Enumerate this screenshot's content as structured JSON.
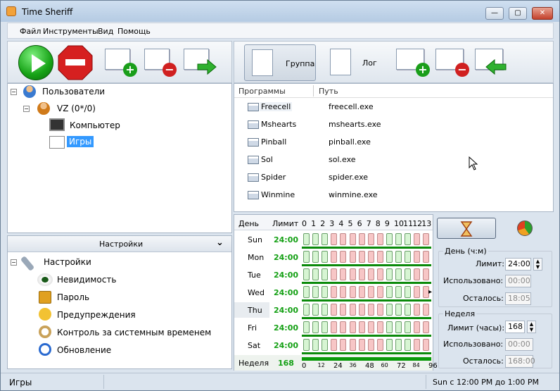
{
  "window": {
    "title": "Time Sheriff",
    "minimize": "—",
    "maximize": "▢",
    "close": "✕"
  },
  "menu": [
    "Файл",
    "Инструменты",
    "Вид",
    "Помощь"
  ],
  "toolbar_right": {
    "group_label": "Группа",
    "log_label": "Лог"
  },
  "users_tree": {
    "root": "Пользователи",
    "user": "VZ (0*/0)",
    "computer": "Компьютер",
    "games": "Игры"
  },
  "settings": {
    "header": "Настройки",
    "root": "Настройки",
    "items": [
      "Невидимость",
      "Пароль",
      "Предупреждения",
      "Контроль за системным временем",
      "Обновление"
    ]
  },
  "programs": {
    "col_programs": "Программы",
    "col_path": "Путь",
    "rows": [
      {
        "name": "Freecell",
        "path": "freecell.exe"
      },
      {
        "name": "Mshearts",
        "path": "mshearts.exe"
      },
      {
        "name": "Pinball",
        "path": "pinball.exe"
      },
      {
        "name": "Sol",
        "path": "sol.exe"
      },
      {
        "name": "Spider",
        "path": "spider.exe"
      },
      {
        "name": "Winmine",
        "path": "winmine.exe"
      }
    ]
  },
  "schedule": {
    "col_day": "День",
    "col_limit": "Лимит",
    "hours": [
      "0",
      "1",
      "2",
      "3",
      "4",
      "5",
      "6",
      "7",
      "8",
      "9",
      "10",
      "11",
      "12",
      "13"
    ],
    "days": [
      {
        "name": "Sun",
        "limit": "24:00"
      },
      {
        "name": "Mon",
        "limit": "24:00"
      },
      {
        "name": "Tue",
        "limit": "24:00"
      },
      {
        "name": "Wed",
        "limit": "24:00"
      },
      {
        "name": "Thu",
        "limit": "24:00"
      },
      {
        "name": "Fri",
        "limit": "24:00"
      },
      {
        "name": "Sat",
        "limit": "24:00"
      }
    ],
    "week_label": "Неделя",
    "week_limit": "168",
    "week_ticks": [
      "0",
      "12",
      "24",
      "36",
      "48",
      "60",
      "72",
      "84",
      "96"
    ]
  },
  "day_box": {
    "title": "День (ч:м)",
    "limit_label": "Лимит:",
    "limit": "24:00",
    "used_label": "Использовано:",
    "used": "00:00",
    "left_label": "Осталось:",
    "left": "18:05"
  },
  "week_box": {
    "title": "Неделя",
    "limit_label": "Лимит (часы):",
    "limit": "168",
    "used_label": "Использовано:",
    "used": "00:00",
    "left_label": "Осталось:",
    "left": "168:00"
  },
  "status": {
    "left": "Игры",
    "right": "Sun с 12:00 PM до 1:00 PM"
  }
}
